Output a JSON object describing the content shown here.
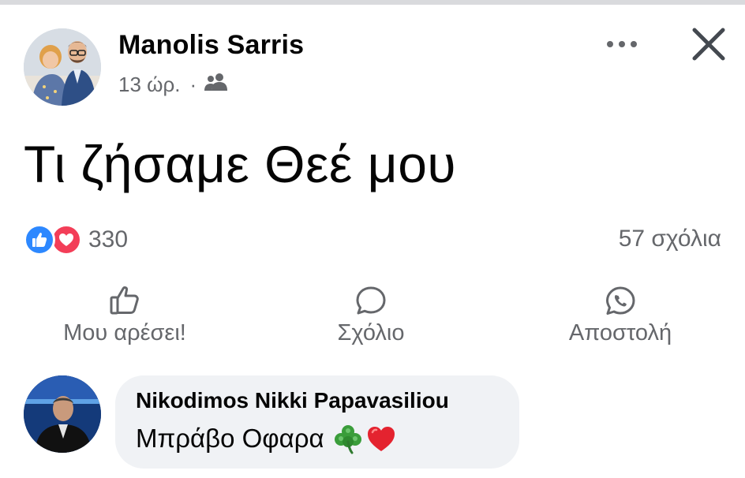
{
  "post": {
    "author": "Manolis Sarris",
    "time": "13 ώρ.",
    "separator": "·",
    "audience_icon": "friends-icon",
    "text": "Τι ζήσαμε Θεέ μου",
    "reactions_count": "330",
    "reaction_icons": [
      "like-reaction-icon",
      "love-reaction-icon"
    ],
    "comments_count": "57 σχόλια"
  },
  "actions": {
    "like": "Μου αρέσει!",
    "comment": "Σχόλιο",
    "share": "Αποστολή"
  },
  "comment": {
    "author": "Nikodimos Nikki Papavasiliou",
    "text": "Μπράβο Οφαρα",
    "emojis": [
      "shamrock-emoji",
      "red-heart-emoji"
    ]
  },
  "colors": {
    "like_blue": "#2d88ff",
    "love_red": "#f33e58",
    "secondary_text": "#65676b",
    "bubble_bg": "#f0f2f5"
  }
}
